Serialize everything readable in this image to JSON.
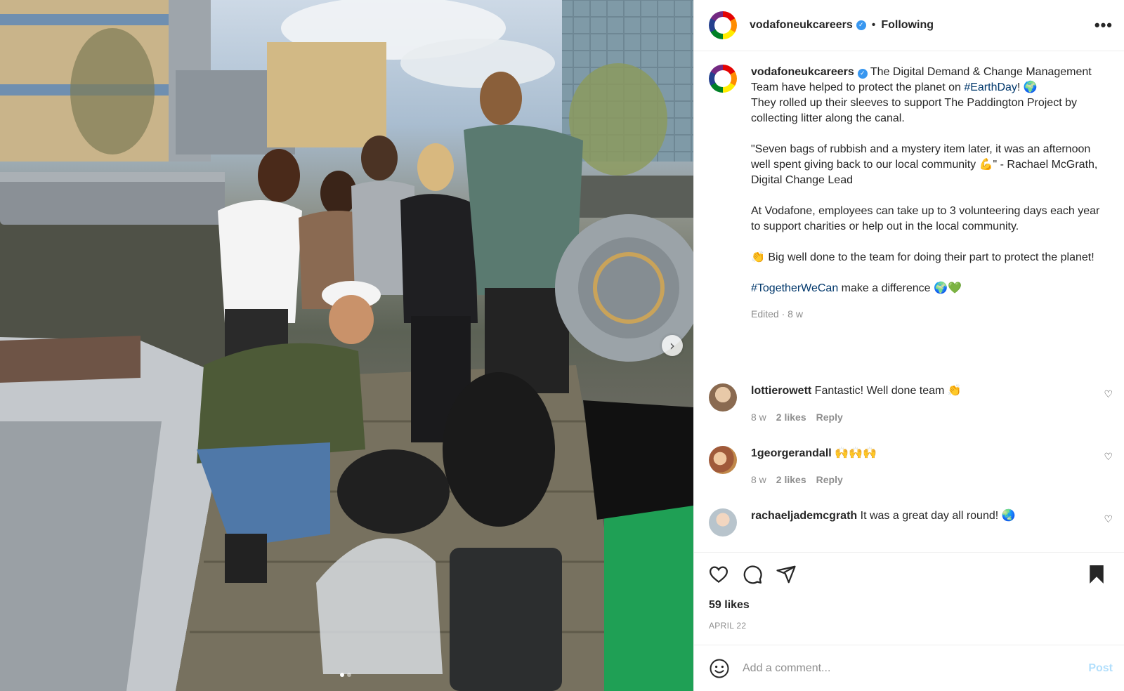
{
  "post": {
    "account": "vodafoneukcareers",
    "follow_status": "Following",
    "more_label": "•••",
    "caption_intro": "The Digital Demand & Change Management Team have helped to protect the planet on ",
    "caption_hashtag1": "#EarthDay",
    "caption_after_hashtag1": "! 🌍",
    "caption_para1": "They rolled up their sleeves to support The Paddington Project by collecting litter along the canal.",
    "caption_para2": "\"Seven bags of rubbish and a mystery item later, it was an afternoon well spent giving back to our local community 💪\" - Rachael McGrath, Digital Change Lead",
    "caption_para3": "At Vodafone, employees can take up to 3 volunteering days each year to support charities or help out in the local community.",
    "caption_para4": "👏 Big well done to the team for doing their part to protect the planet!",
    "caption_hashtag2": "#TogetherWeCan",
    "caption_end": " make a difference 🌍💚",
    "edited_meta": "Edited · 8 w",
    "likes": "59 likes",
    "date": "APRIL 22"
  },
  "comments": [
    {
      "user": "lottierowett",
      "text": "Fantastic! Well done team 👏",
      "age": "8 w",
      "likes": "2 likes",
      "reply": "Reply"
    },
    {
      "user": "1georgerandall",
      "text": "🙌🙌🙌",
      "age": "8 w",
      "likes": "2 likes",
      "reply": "Reply"
    },
    {
      "user": "rachaeljademcgrath",
      "text": "It was a great day all round! 🌏"
    }
  ],
  "composer": {
    "placeholder": "Add a comment...",
    "post_label": "Post"
  },
  "icons": {
    "heart": "heart-icon",
    "comment": "comment-icon",
    "share": "share-icon",
    "bookmark": "bookmark-icon",
    "emoji": "emoji-icon",
    "next": "chevron-right-icon"
  },
  "colors": {
    "hashtag": "#00376b",
    "verified": "#3897f0",
    "post_button": "#b2dffc",
    "muted": "#8e8e8e"
  }
}
